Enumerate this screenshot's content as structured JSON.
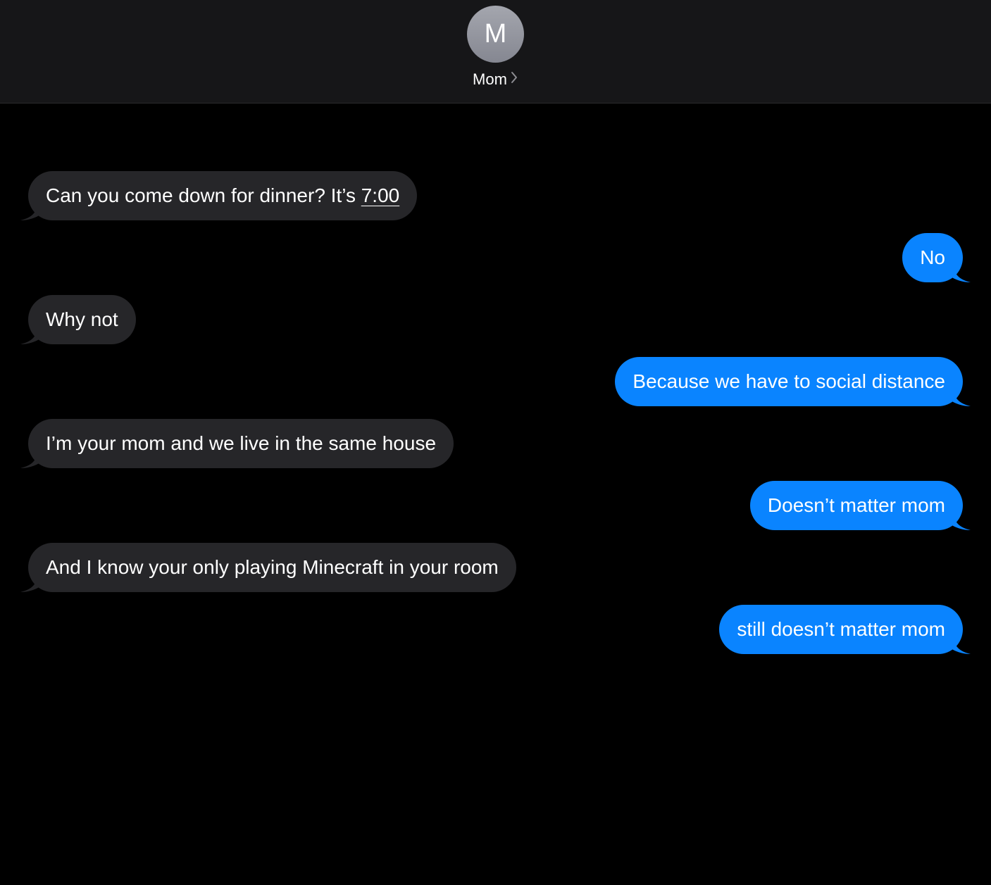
{
  "header": {
    "avatar_initial": "M",
    "contact_name": "Mom"
  },
  "colors": {
    "incoming_bubble": "#262629",
    "outgoing_bubble": "#0a84ff",
    "background": "#000000",
    "header_background": "#161618"
  },
  "messages": [
    {
      "direction": "incoming",
      "text": "Can you come down for dinner? It’s ",
      "link": "7:00"
    },
    {
      "direction": "outgoing",
      "text": "No"
    },
    {
      "direction": "incoming",
      "text": "Why not"
    },
    {
      "direction": "outgoing",
      "text": "Because we have to social distance"
    },
    {
      "direction": "incoming",
      "text": "I’m your mom and we live in the same house"
    },
    {
      "direction": "outgoing",
      "text": "Doesn’t matter mom"
    },
    {
      "direction": "incoming",
      "text": "And I know your only playing Minecraft in your room"
    },
    {
      "direction": "outgoing",
      "text": "still doesn’t matter mom"
    }
  ]
}
